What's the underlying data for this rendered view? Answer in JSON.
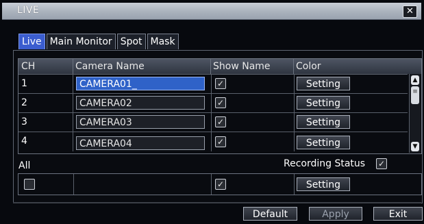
{
  "window": {
    "title": "LIVE",
    "close_icon": "close-icon"
  },
  "tabs": [
    {
      "label": "Live",
      "active": true
    },
    {
      "label": "Main Monitor",
      "active": false
    },
    {
      "label": "Spot",
      "active": false
    },
    {
      "label": "Mask",
      "active": false
    }
  ],
  "table": {
    "headers": [
      "CH",
      "Camera Name",
      "Show Name",
      "Color"
    ],
    "rows": [
      {
        "ch": "1",
        "name": "CAMERA01_",
        "show": true,
        "color_btn": "Setting",
        "active": true
      },
      {
        "ch": "2",
        "name": "CAMERA02",
        "show": true,
        "color_btn": "Setting"
      },
      {
        "ch": "3",
        "name": "CAMERA03",
        "show": true,
        "color_btn": "Setting"
      },
      {
        "ch": "4",
        "name": "CAMERA04",
        "show": true,
        "color_btn": "Setting"
      }
    ]
  },
  "all_section": {
    "label": "All",
    "recording_status_label": "Recording Status",
    "recording_status_checked": true,
    "all_checked": false,
    "show_checked": true,
    "color_btn": "Setting"
  },
  "footer": {
    "default": "Default",
    "apply": "Apply",
    "exit": "Exit"
  }
}
